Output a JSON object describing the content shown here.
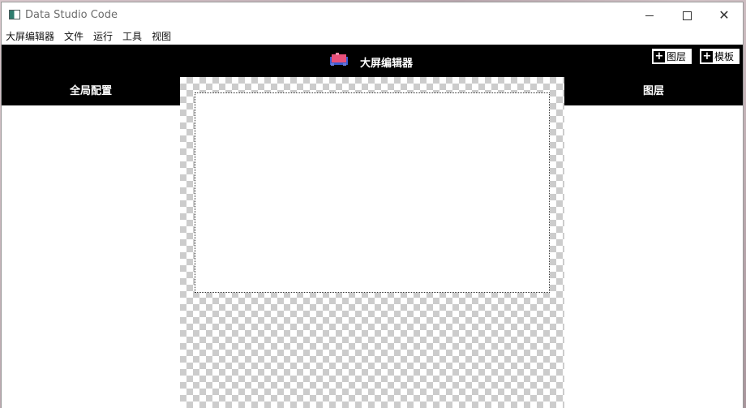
{
  "window": {
    "title": "Data Studio Code"
  },
  "menu": {
    "items": [
      "大屏编辑器",
      "文件",
      "运行",
      "工具",
      "视图"
    ]
  },
  "header": {
    "title": "大屏编辑器",
    "buttons": {
      "layer_label": "图层",
      "template_label": "模板",
      "plus_glyph": "+"
    }
  },
  "left_panel": {
    "title": "全局配置"
  },
  "right_panel": {
    "title": "图层"
  },
  "colors": {
    "header_bg": "#000000",
    "checker": "#cccccc",
    "logo_pink": "#e8507a",
    "logo_blue": "#3a5bd0"
  },
  "icons": [
    "app-icon",
    "logo-icon",
    "plus-icon",
    "minimize-icon",
    "maximize-icon",
    "close-icon"
  ]
}
